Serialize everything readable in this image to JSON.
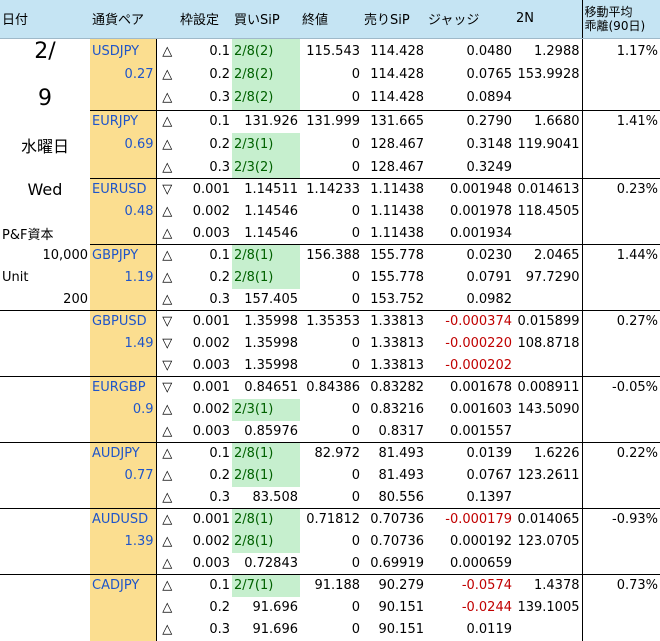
{
  "headers": [
    "日付",
    "通貨ペア",
    "",
    "枠設定",
    "買いSiP",
    "終値",
    "売りSiP",
    "ジャッジ",
    "2N",
    "移動平均\n乖離(90日)"
  ],
  "side": {
    "date_top": "2/",
    "date_bottom": "9",
    "weekday_jp": "水曜日",
    "weekday_en": "Wed",
    "capital_label": "P&F資本",
    "capital_value": "10,000",
    "unit_label": "Unit",
    "unit_value": "200"
  },
  "pairs": [
    {
      "name": "USDJPY",
      "value": "0.27",
      "ma": "1.17%",
      "rows": [
        {
          "dir": "△",
          "frame": "0.1",
          "buy": "2/8(2)",
          "buy_green": true,
          "close": "115.543",
          "sell": "114.428",
          "judge": "0.0480",
          "judge_neg": false,
          "n2": "1.2988"
        },
        {
          "dir": "△",
          "frame": "0.2",
          "buy": "2/8(2)",
          "buy_green": true,
          "close": "0",
          "sell": "114.428",
          "judge": "0.0765",
          "judge_neg": false,
          "n2": "153.9928"
        },
        {
          "dir": "△",
          "frame": "0.3",
          "buy": "2/8(2)",
          "buy_green": true,
          "close": "0",
          "sell": "114.428",
          "judge": "0.0894",
          "judge_neg": false,
          "n2": ""
        }
      ]
    },
    {
      "name": "EURJPY",
      "value": "0.69",
      "ma": "1.41%",
      "rows": [
        {
          "dir": "△",
          "frame": "0.1",
          "buy": "131.926",
          "buy_green": false,
          "close": "131.999",
          "sell": "131.665",
          "judge": "0.2790",
          "judge_neg": false,
          "n2": "1.6680"
        },
        {
          "dir": "△",
          "frame": "0.2",
          "buy": "2/3(1)",
          "buy_green": true,
          "close": "0",
          "sell": "128.467",
          "judge": "0.3148",
          "judge_neg": false,
          "n2": "119.9041"
        },
        {
          "dir": "△",
          "frame": "0.3",
          "buy": "2/3(2)",
          "buy_green": true,
          "close": "0",
          "sell": "128.467",
          "judge": "0.3249",
          "judge_neg": false,
          "n2": ""
        }
      ]
    },
    {
      "name": "EURUSD",
      "value": "0.48",
      "ma": "0.23%",
      "rows": [
        {
          "dir": "▽",
          "frame": "0.001",
          "buy": "1.14511",
          "buy_green": false,
          "close": "1.14233",
          "sell": "1.11438",
          "judge": "0.001948",
          "judge_neg": false,
          "n2": "0.014613"
        },
        {
          "dir": "△",
          "frame": "0.002",
          "buy": "1.14546",
          "buy_green": false,
          "close": "0",
          "sell": "1.11438",
          "judge": "0.001978",
          "judge_neg": false,
          "n2": "118.4505"
        },
        {
          "dir": "△",
          "frame": "0.003",
          "buy": "1.14546",
          "buy_green": false,
          "close": "0",
          "sell": "1.11438",
          "judge": "0.001934",
          "judge_neg": false,
          "n2": ""
        }
      ]
    },
    {
      "name": "GBPJPY",
      "value": "1.19",
      "ma": "1.44%",
      "rows": [
        {
          "dir": "△",
          "frame": "0.1",
          "buy": "2/8(1)",
          "buy_green": true,
          "close": "156.388",
          "sell": "155.778",
          "judge": "0.0230",
          "judge_neg": false,
          "n2": "2.0465"
        },
        {
          "dir": "△",
          "frame": "0.2",
          "buy": "2/8(1)",
          "buy_green": true,
          "close": "0",
          "sell": "155.778",
          "judge": "0.0791",
          "judge_neg": false,
          "n2": "97.7290"
        },
        {
          "dir": "△",
          "frame": "0.3",
          "buy": "157.405",
          "buy_green": false,
          "close": "0",
          "sell": "153.752",
          "judge": "0.0982",
          "judge_neg": false,
          "n2": ""
        }
      ]
    },
    {
      "name": "GBPUSD",
      "value": "1.49",
      "ma": "0.27%",
      "rows": [
        {
          "dir": "▽",
          "frame": "0.001",
          "buy": "1.35998",
          "buy_green": false,
          "close": "1.35353",
          "sell": "1.33813",
          "judge": "-0.000374",
          "judge_neg": true,
          "n2": "0.015899"
        },
        {
          "dir": "▽",
          "frame": "0.002",
          "buy": "1.35998",
          "buy_green": false,
          "close": "0",
          "sell": "1.33813",
          "judge": "-0.000220",
          "judge_neg": true,
          "n2": "108.8718"
        },
        {
          "dir": "▽",
          "frame": "0.003",
          "buy": "1.35998",
          "buy_green": false,
          "close": "0",
          "sell": "1.33813",
          "judge": "-0.000202",
          "judge_neg": true,
          "n2": ""
        }
      ]
    },
    {
      "name": "EURGBP",
      "value": "0.9",
      "ma": "-0.05%",
      "rows": [
        {
          "dir": "▽",
          "frame": "0.001",
          "buy": "0.84651",
          "buy_green": false,
          "close": "0.84386",
          "sell": "0.83282",
          "judge": "0.001678",
          "judge_neg": false,
          "n2": "0.008911"
        },
        {
          "dir": "△",
          "frame": "0.002",
          "buy": "2/3(1)",
          "buy_green": true,
          "close": "0",
          "sell": "0.83216",
          "judge": "0.001603",
          "judge_neg": false,
          "n2": "143.5090"
        },
        {
          "dir": "△",
          "frame": "0.003",
          "buy": "0.85976",
          "buy_green": false,
          "close": "0",
          "sell": "0.8317",
          "judge": "0.001557",
          "judge_neg": false,
          "n2": ""
        }
      ]
    },
    {
      "name": "AUDJPY",
      "value": "0.77",
      "ma": "0.22%",
      "rows": [
        {
          "dir": "△",
          "frame": "0.1",
          "buy": "2/8(1)",
          "buy_green": true,
          "close": "82.972",
          "sell": "81.493",
          "judge": "0.0139",
          "judge_neg": false,
          "n2": "1.6226"
        },
        {
          "dir": "△",
          "frame": "0.2",
          "buy": "2/8(1)",
          "buy_green": true,
          "close": "0",
          "sell": "81.493",
          "judge": "0.0767",
          "judge_neg": false,
          "n2": "123.2611"
        },
        {
          "dir": "△",
          "frame": "0.3",
          "buy": "83.508",
          "buy_green": false,
          "close": "0",
          "sell": "80.556",
          "judge": "0.1397",
          "judge_neg": false,
          "n2": ""
        }
      ]
    },
    {
      "name": "AUDUSD",
      "value": "1.39",
      "ma": "-0.93%",
      "rows": [
        {
          "dir": "△",
          "frame": "0.001",
          "buy": "2/8(1)",
          "buy_green": true,
          "close": "0.71812",
          "sell": "0.70736",
          "judge": "-0.000179",
          "judge_neg": true,
          "n2": "0.014065"
        },
        {
          "dir": "△",
          "frame": "0.002",
          "buy": "2/8(1)",
          "buy_green": true,
          "close": "0",
          "sell": "0.70736",
          "judge": "0.000192",
          "judge_neg": false,
          "n2": "123.0705"
        },
        {
          "dir": "△",
          "frame": "0.003",
          "buy": "0.72843",
          "buy_green": false,
          "close": "0",
          "sell": "0.69919",
          "judge": "0.000659",
          "judge_neg": false,
          "n2": ""
        }
      ]
    },
    {
      "name": "CADJPY",
      "value": "",
      "ma": "0.73%",
      "rows": [
        {
          "dir": "△",
          "frame": "0.1",
          "buy": "2/7(1)",
          "buy_green": true,
          "close": "91.188",
          "sell": "90.279",
          "judge": "-0.0574",
          "judge_neg": true,
          "n2": "1.4378"
        },
        {
          "dir": "△",
          "frame": "0.2",
          "buy": "91.696",
          "buy_green": false,
          "close": "0",
          "sell": "90.151",
          "judge": "-0.0244",
          "judge_neg": true,
          "n2": "139.1005"
        },
        {
          "dir": "△",
          "frame": "0.3",
          "buy": "91.696",
          "buy_green": false,
          "close": "0",
          "sell": "90.151",
          "judge": "0.0119",
          "judge_neg": false,
          "n2": ""
        }
      ]
    }
  ],
  "colors": {
    "header_bg": "#c5e4f3",
    "pair_bg": "#fbde90",
    "pair_text": "#1f55c9",
    "buy_green_bg": "#c6efce",
    "buy_green_text": "#006100",
    "negative": "#c00000"
  }
}
